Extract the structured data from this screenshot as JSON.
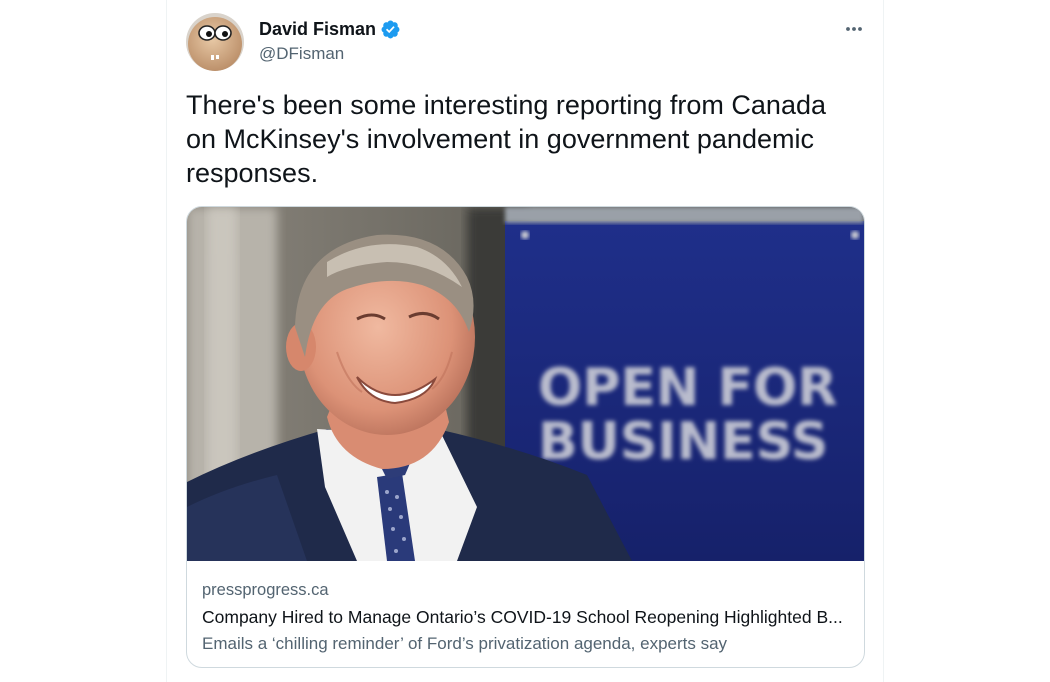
{
  "tweet": {
    "author": {
      "display_name": "David Fisman",
      "handle": "@DFisman",
      "verified": true,
      "avatar_icon": "cartoon-avatar"
    },
    "more_icon": "more-horizontal-icon",
    "text": "There's been some interesting reporting from Canada on McKinsey's involvement in government pandemic responses.",
    "card": {
      "image_sign_line1": "OPEN FOR",
      "image_sign_line2": "BUSINESS",
      "domain": "pressprogress.ca",
      "title": "Company Hired to Manage Ontario’s COVID-19 School Reopening Highlighted B...",
      "description": "Emails a ‘chilling reminder’ of Ford’s privatization agenda, experts say"
    }
  },
  "colors": {
    "verified_blue": "#1d9bf0",
    "text_primary": "#0f1419",
    "text_secondary": "#536471",
    "border": "#cfd9de"
  }
}
